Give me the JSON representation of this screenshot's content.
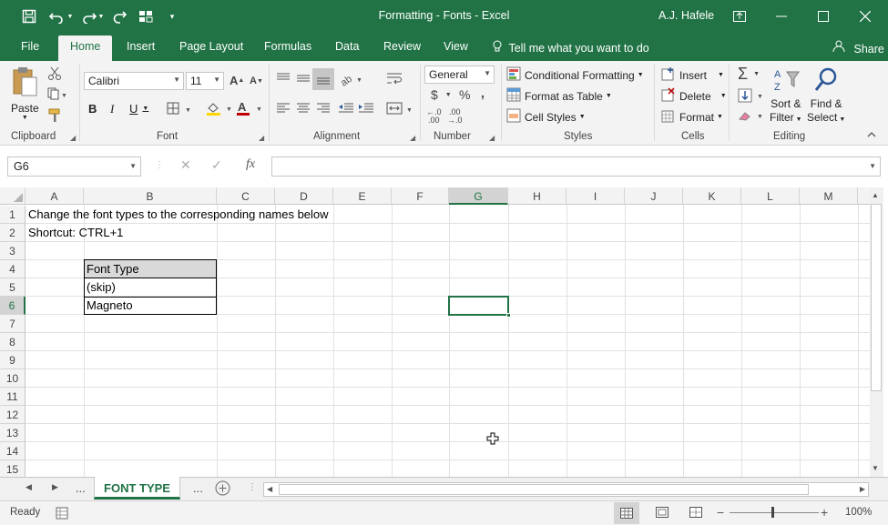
{
  "title_bar": {
    "title": "Formatting - Fonts  -  Excel",
    "user": "A.J. Hafele"
  },
  "menu": {
    "tabs": [
      "File",
      "Home",
      "Insert",
      "Page Layout",
      "Formulas",
      "Data",
      "Review",
      "View"
    ],
    "active_tab": "Home",
    "tell_me": "Tell me what you want to do",
    "share": "Share"
  },
  "ribbon": {
    "clipboard": {
      "label": "Clipboard",
      "paste": "Paste"
    },
    "font": {
      "label": "Font",
      "font_name": "Calibri",
      "font_size": "11"
    },
    "alignment": {
      "label": "Alignment"
    },
    "number": {
      "label": "Number",
      "format": "General"
    },
    "styles": {
      "label": "Styles",
      "conditional": "Conditional Formatting",
      "format_table": "Format as Table",
      "cell_styles": "Cell Styles"
    },
    "cells": {
      "label": "Cells",
      "insert": "Insert",
      "delete": "Delete",
      "format": "Format"
    },
    "editing": {
      "label": "Editing",
      "sort_filter_1": "Sort &",
      "sort_filter_2": "Filter",
      "find_select_1": "Find &",
      "find_select_2": "Select"
    }
  },
  "formula_bar": {
    "name_box": "G6",
    "formula": ""
  },
  "grid": {
    "columns": [
      "A",
      "B",
      "C",
      "D",
      "E",
      "F",
      "G",
      "H",
      "I",
      "J",
      "K",
      "L",
      "M"
    ],
    "rows": [
      "1",
      "2",
      "3",
      "4",
      "5",
      "6",
      "7",
      "8",
      "9",
      "10",
      "11",
      "12",
      "13",
      "14",
      "15"
    ],
    "selected_cell": "G6",
    "a1": "Change the font types to the corresponding names below",
    "a2": "Shortcut: CTRL+1",
    "b4": "Font Type",
    "b5": "(skip)",
    "b6": "Magneto"
  },
  "sheet_tabs": {
    "active": "FONT TYPE",
    "ellipsis": "..."
  },
  "status": {
    "mode": "Ready",
    "zoom": "100%"
  },
  "colors": {
    "excel_green": "#217346",
    "header_fill": "#d9d9d9"
  }
}
